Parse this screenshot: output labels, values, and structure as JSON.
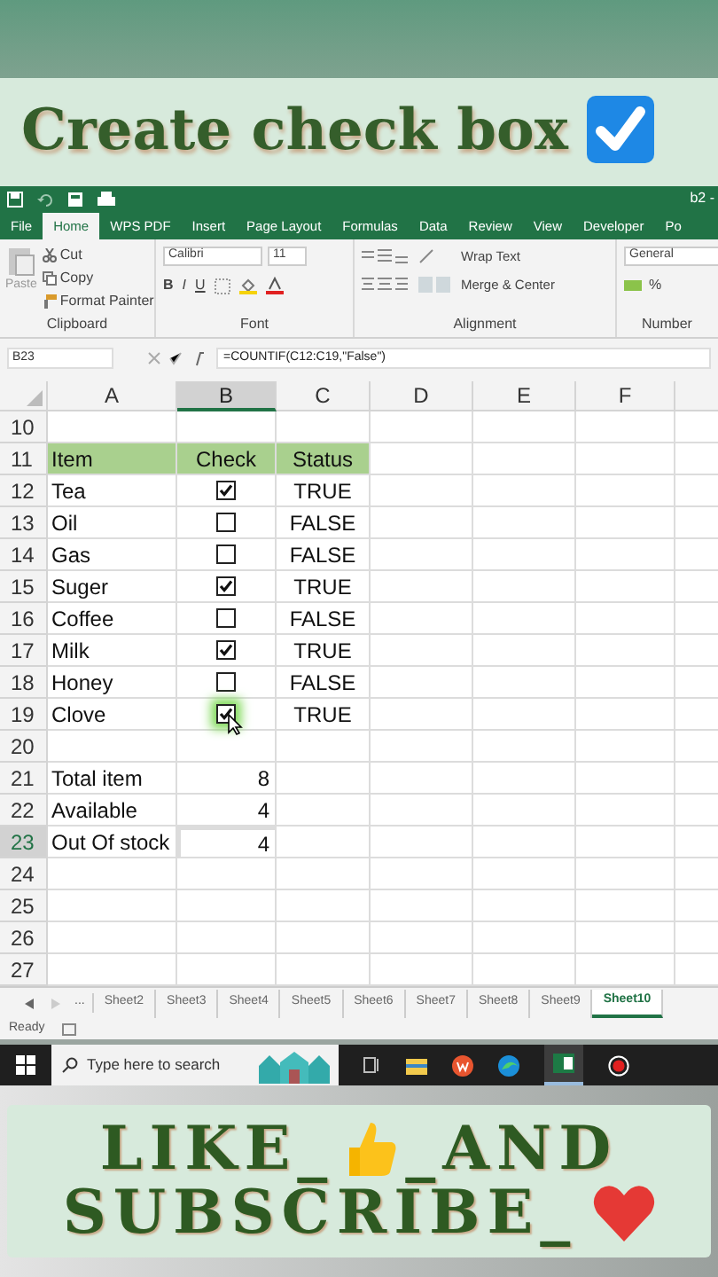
{
  "title_banner": {
    "text": "Create check box"
  },
  "excel": {
    "title_bar": {
      "text": "b2 -"
    },
    "ribbon_tabs": [
      {
        "label": "File",
        "selected": false
      },
      {
        "label": "Home",
        "selected": true
      },
      {
        "label": "WPS PDF",
        "selected": false
      },
      {
        "label": "Insert",
        "selected": false
      },
      {
        "label": "Page Layout",
        "selected": false
      },
      {
        "label": "Formulas",
        "selected": false
      },
      {
        "label": "Data",
        "selected": false
      },
      {
        "label": "Review",
        "selected": false
      },
      {
        "label": "View",
        "selected": false
      },
      {
        "label": "Developer",
        "selected": false
      },
      {
        "label": "Po",
        "selected": false
      }
    ],
    "ribbon": {
      "paste": "Paste",
      "cut": "Cut",
      "copy": "Copy",
      "format_painter": "Format Painter",
      "clipboard": "Clipboard",
      "font_name": "Calibri",
      "font_size": "11",
      "font_styles": [
        "B",
        "I",
        "U"
      ],
      "font": "Font",
      "wrap_text": "Wrap Text",
      "merge_center": "Merge & Center",
      "alignment": "Alignment",
      "number_format": "General",
      "percent": "%",
      "number": "Number"
    },
    "name_box": "B23",
    "formula": "=COUNTIF(C12:C19,\"False\")",
    "columns": [
      {
        "label": "A",
        "selected": false
      },
      {
        "label": "B",
        "selected": true
      },
      {
        "label": "C",
        "selected": false
      },
      {
        "label": "D",
        "selected": false
      },
      {
        "label": "E",
        "selected": false
      },
      {
        "label": "F",
        "selected": false
      }
    ],
    "rows": [
      {
        "kind": "empty",
        "number": "10"
      },
      {
        "kind": "header",
        "number": "11",
        "cells": [
          "Item",
          "Check",
          "Status"
        ]
      },
      {
        "kind": "item",
        "number": "12",
        "item": "Tea",
        "checked": true,
        "status": "TRUE"
      },
      {
        "kind": "item",
        "number": "13",
        "item": "Oil",
        "checked": false,
        "status": "FALSE"
      },
      {
        "kind": "item",
        "number": "14",
        "item": "Gas",
        "checked": false,
        "status": "FALSE"
      },
      {
        "kind": "item",
        "number": "15",
        "item": "Suger",
        "checked": true,
        "status": "TRUE"
      },
      {
        "kind": "item",
        "number": "16",
        "item": "Coffee",
        "checked": false,
        "status": "FALSE"
      },
      {
        "kind": "item",
        "number": "17",
        "item": "Milk",
        "checked": true,
        "status": "TRUE"
      },
      {
        "kind": "item",
        "number": "18",
        "item": "Honey",
        "checked": false,
        "status": "FALSE"
      },
      {
        "kind": "item",
        "number": "19",
        "item": "Clove",
        "checked": true,
        "status": "TRUE",
        "hovered": true
      },
      {
        "kind": "empty",
        "number": "20"
      },
      {
        "kind": "total",
        "number": "21",
        "label": "Total item",
        "value": "8",
        "selected": false
      },
      {
        "kind": "total",
        "number": "22",
        "label": "Available",
        "value": "4",
        "selected": false
      },
      {
        "kind": "total",
        "number": "23",
        "label": "Out Of stock",
        "value": "4",
        "selected": true
      },
      {
        "kind": "empty",
        "number": "24"
      },
      {
        "kind": "empty",
        "number": "25"
      },
      {
        "kind": "empty",
        "number": "26"
      },
      {
        "kind": "empty",
        "number": "27"
      }
    ],
    "sheet_overflow": "...",
    "sheet_tabs": [
      {
        "label": "Sheet2",
        "selected": false
      },
      {
        "label": "Sheet3",
        "selected": false
      },
      {
        "label": "Sheet4",
        "selected": false
      },
      {
        "label": "Sheet5",
        "selected": false
      },
      {
        "label": "Sheet6",
        "selected": false
      },
      {
        "label": "Sheet7",
        "selected": false
      },
      {
        "label": "Sheet8",
        "selected": false
      },
      {
        "label": "Sheet9",
        "selected": false
      },
      {
        "label": "Sheet10",
        "selected": true
      }
    ],
    "status": "Ready"
  },
  "taskbar": {
    "search_placeholder": "Type here to search"
  },
  "subscribe_banner": {
    "like": "LIKE_",
    "and": "_AND",
    "subscribe": "SUBSCRIBE_"
  }
}
